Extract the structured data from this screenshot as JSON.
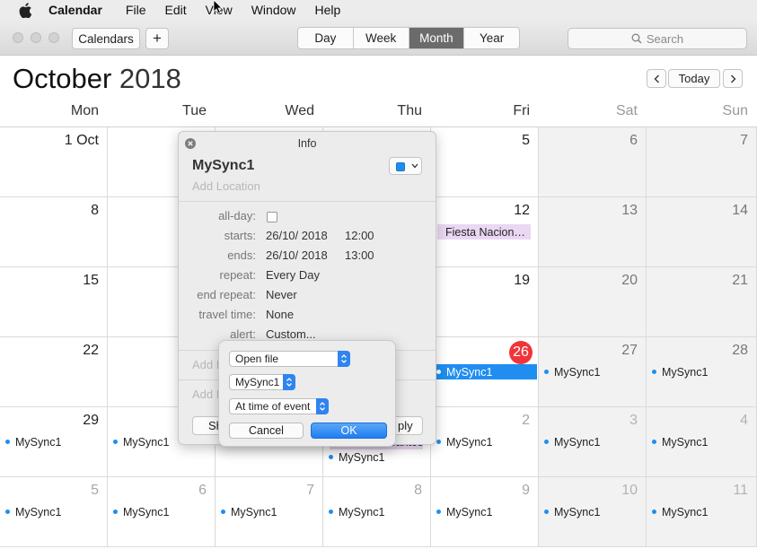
{
  "menubar": {
    "app_name": "Calendar",
    "items": [
      "File",
      "Edit",
      "View",
      "Window",
      "Help"
    ]
  },
  "toolbar": {
    "calendars_label": "Calendars",
    "add_label": "+",
    "views": [
      {
        "label": "Day",
        "selected": false
      },
      {
        "label": "Week",
        "selected": false
      },
      {
        "label": "Month",
        "selected": true
      },
      {
        "label": "Year",
        "selected": false
      }
    ],
    "search_placeholder": "Search"
  },
  "header": {
    "month": "October",
    "year": "2018",
    "prev_label": "<",
    "today_label": "Today",
    "next_label": ">"
  },
  "weekdays": [
    "Mon",
    "Tue",
    "Wed",
    "Thu",
    "Fri",
    "Sat",
    "Sun"
  ],
  "weeks": [
    [
      {
        "d": "1 Oct",
        "ev": []
      },
      {
        "d": "",
        "ev": []
      },
      {
        "d": "",
        "ev": []
      },
      {
        "d": "",
        "ev": []
      },
      {
        "d": "5",
        "ev": []
      },
      {
        "d": "6",
        "ev": []
      },
      {
        "d": "7",
        "ev": []
      }
    ],
    [
      {
        "d": "8",
        "ev": []
      },
      {
        "d": "",
        "ev": []
      },
      {
        "d": "",
        "ev": []
      },
      {
        "d": "",
        "ev": []
      },
      {
        "d": "12",
        "ev": [
          {
            "t": "Fiesta Nacion…",
            "k": "holiday"
          }
        ]
      },
      {
        "d": "13",
        "ev": []
      },
      {
        "d": "14",
        "ev": []
      }
    ],
    [
      {
        "d": "15",
        "ev": []
      },
      {
        "d": "",
        "ev": []
      },
      {
        "d": "",
        "ev": []
      },
      {
        "d": "",
        "ev": []
      },
      {
        "d": "19",
        "ev": []
      },
      {
        "d": "20",
        "ev": []
      },
      {
        "d": "21",
        "ev": []
      }
    ],
    [
      {
        "d": "22",
        "ev": []
      },
      {
        "d": "",
        "ev": []
      },
      {
        "d": "",
        "ev": []
      },
      {
        "d": "",
        "ev": []
      },
      {
        "d": "26",
        "today": true,
        "ev": [
          {
            "t": "MySync1",
            "k": "selected"
          }
        ]
      },
      {
        "d": "27",
        "ev": [
          {
            "t": "MySync1"
          }
        ]
      },
      {
        "d": "28",
        "ev": [
          {
            "t": "MySync1"
          }
        ]
      }
    ],
    [
      {
        "d": "29",
        "ev": [
          {
            "t": "MySync1"
          }
        ]
      },
      {
        "d": "",
        "ev": [
          {
            "t": "MySync1"
          }
        ]
      },
      {
        "d": "",
        "ev": []
      },
      {
        "d": "",
        "ev": [
          {
            "t": "Todos los Santos",
            "k": "holiday"
          },
          {
            "t": "MySync1"
          }
        ]
      },
      {
        "d": "2",
        "out": true,
        "ev": [
          {
            "t": "MySync1"
          }
        ]
      },
      {
        "d": "3",
        "out": true,
        "ev": [
          {
            "t": "MySync1"
          }
        ]
      },
      {
        "d": "4",
        "out": true,
        "ev": [
          {
            "t": "MySync1"
          }
        ]
      }
    ],
    [
      {
        "d": "5",
        "out": true,
        "ev": [
          {
            "t": "MySync1"
          }
        ]
      },
      {
        "d": "6",
        "out": true,
        "ev": [
          {
            "t": "MySync1"
          }
        ]
      },
      {
        "d": "7",
        "out": true,
        "ev": [
          {
            "t": "MySync1"
          }
        ]
      },
      {
        "d": "8",
        "out": true,
        "ev": [
          {
            "t": "MySync1"
          }
        ]
      },
      {
        "d": "9",
        "out": true,
        "ev": [
          {
            "t": "MySync1"
          }
        ]
      },
      {
        "d": "10",
        "out": true,
        "ev": [
          {
            "t": "MySync1"
          }
        ]
      },
      {
        "d": "11",
        "out": true,
        "ev": [
          {
            "t": "MySync1"
          }
        ]
      }
    ]
  ],
  "info": {
    "header": "Info",
    "event_name": "MySync1",
    "location_placeholder": "Add Location",
    "allday_label": "all-day:",
    "starts_label": "starts:",
    "starts_date": "26/10/ 2018",
    "starts_time": "12:00",
    "ends_label": "ends:",
    "ends_date": "26/10/ 2018",
    "ends_time": "13:00",
    "repeat_label": "repeat:",
    "repeat_value": "Every Day",
    "end_repeat_label": "end repeat:",
    "end_repeat_value": "Never",
    "travel_label": "travel time:",
    "travel_value": "None",
    "alert_label": "alert:",
    "alert_value": "Custom...",
    "add_invitees_partial": "Add I",
    "add_notes_partial": "Add I",
    "show_partial": "Sh",
    "apply_partial": "ply"
  },
  "alert": {
    "action": "Open file",
    "file": "MySync1",
    "timing": "At time of event",
    "cancel_label": "Cancel",
    "ok_label": "OK"
  },
  "colors": {
    "accent": "#1f8ef0",
    "today": "#f0353a",
    "holiday": "#ead7f3",
    "weekend_bg": "#f2f2f2"
  }
}
